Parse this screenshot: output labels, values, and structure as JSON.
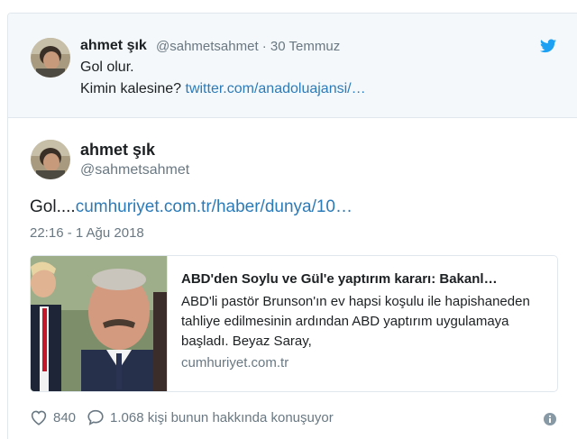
{
  "quoted": {
    "name": "ahmet şık",
    "handle": "@sahmetsahmet · 30 Temmuz",
    "line1": "Gol olur.",
    "line2_prefix": "Kimin kalesine? ",
    "line2_link": "twitter.com/anadoluajansi/…"
  },
  "tweet": {
    "name": "ahmet şık",
    "handle": "@sahmetsahmet",
    "text_prefix": "Gol....",
    "text_link": "cumhuriyet.com.tr/haber/dunya/10…",
    "timestamp": "22:16 - 1 Ağu 2018"
  },
  "card": {
    "title": "ABD'den Soylu ve Gül'e yaptırım kararı: Bakanl…",
    "description": "ABD'li pastör Brunson'ın ev hapsi koşulu ile hapishaneden tahliye edilmesinin ardından ABD yaptırım uygulamaya başladı. Beyaz Saray,",
    "domain": "cumhuriyet.com.tr"
  },
  "footer": {
    "likes": "840",
    "replies_text": "1.068 kişi bunun hakkında konuşuyor"
  },
  "icons": {
    "brand": "twitter-bird-icon",
    "like": "heart-icon",
    "reply": "speech-bubble-icon",
    "info": "info-icon"
  },
  "colors": {
    "link": "#2b7bb9",
    "twitter_blue": "#1da1f2",
    "muted": "#697882",
    "text": "#1c2022"
  }
}
